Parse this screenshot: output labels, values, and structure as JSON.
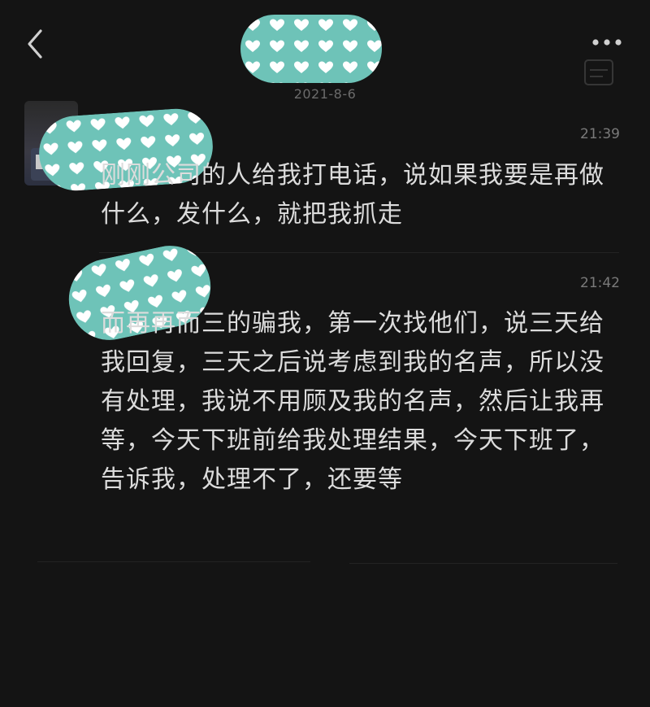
{
  "header": {
    "date": "2021-8-6",
    "back_icon": "chevron-left-icon",
    "more_icon": "more-horizontal-icon"
  },
  "messages": [
    {
      "time": "21:39",
      "text": "刚刚公司的人给我打电话，说如果我要是再做什么，发什么，就把我抓走"
    },
    {
      "time": "21:42",
      "text": "而再再而三的骗我，第一次找他们，说三天给我回复，三天之后说考虑到我的名声，所以没有处理，我说不用顾及我的名声，然后让我再等，今天下班前给我处理结果，今天下班了，告诉我，处理不了，还要等"
    }
  ],
  "colors": {
    "background": "#141414",
    "text": "#dcdcdc",
    "muted": "#6b6b6b",
    "redaction_fill": "#6ec3b8",
    "redaction_heart": "#ffffff"
  }
}
